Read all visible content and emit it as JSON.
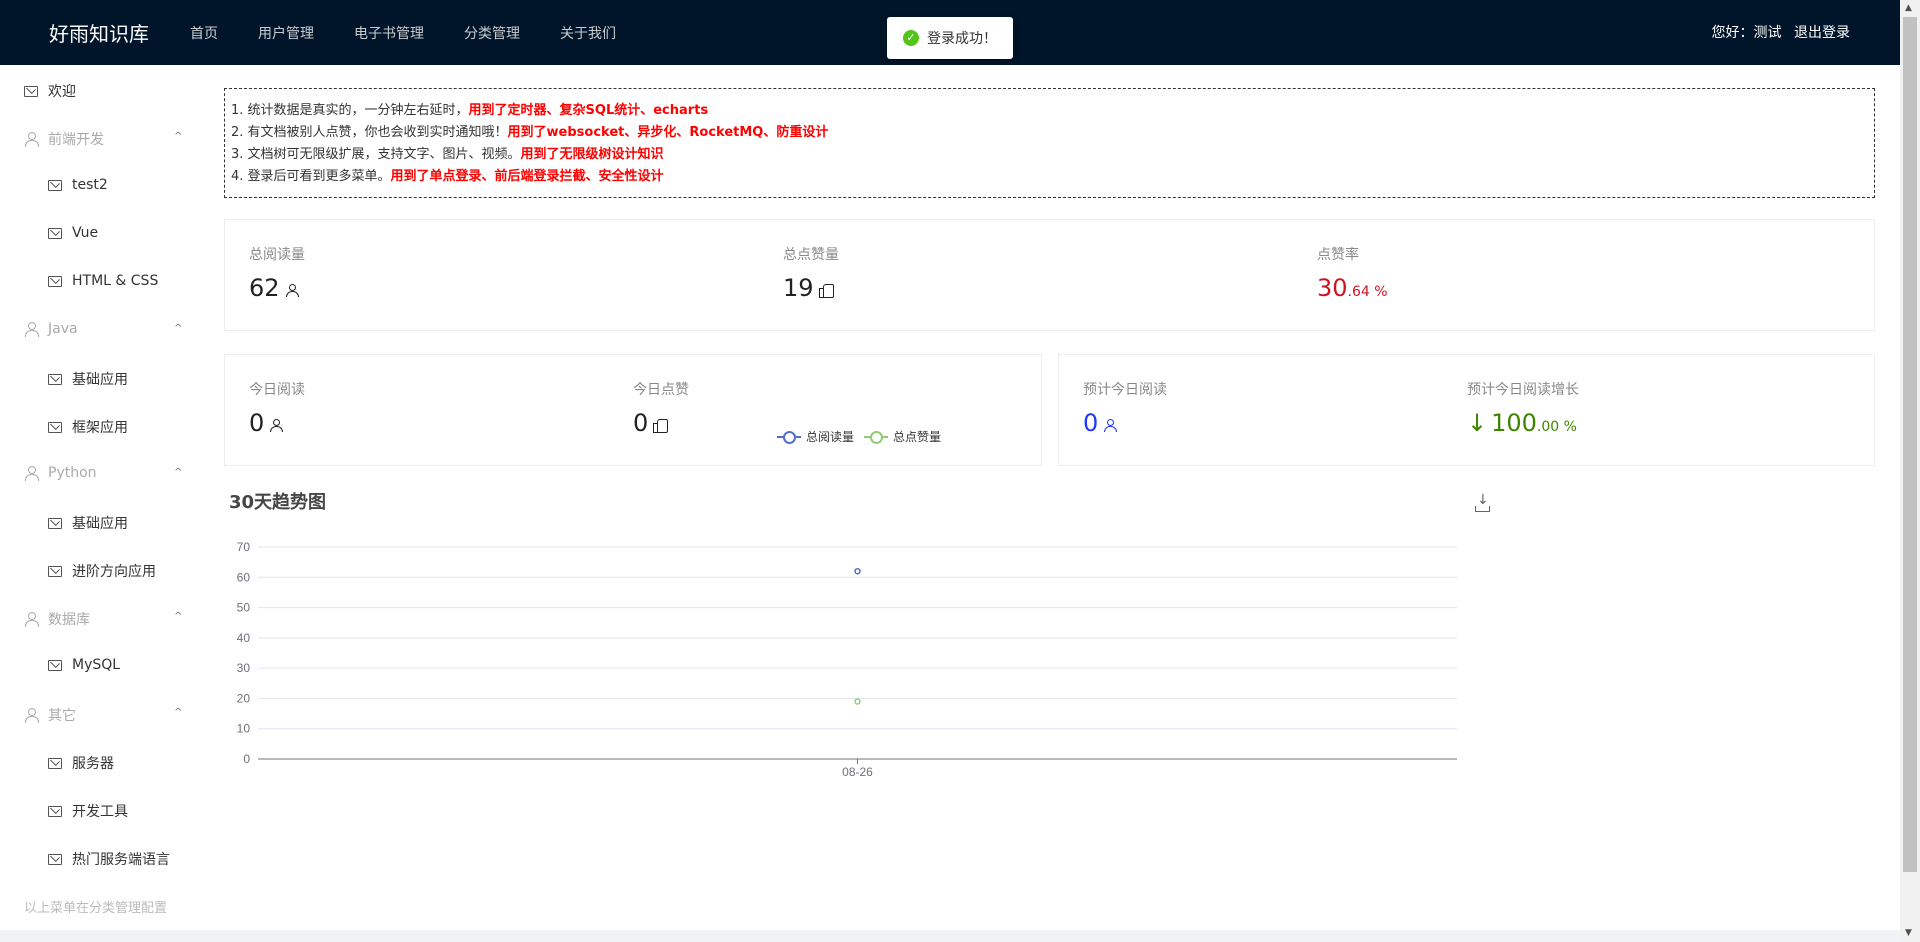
{
  "header": {
    "logo": "好雨知识库",
    "nav": [
      "首页",
      "用户管理",
      "电子书管理",
      "分类管理",
      "关于我们"
    ],
    "greeting": "您好：测试",
    "logout": "退出登录"
  },
  "toast": {
    "message": "登录成功！"
  },
  "sidebar": {
    "welcome": "欢迎",
    "groups": [
      {
        "label": "前端开发",
        "items": [
          "test2",
          "Vue",
          "HTML & CSS"
        ]
      },
      {
        "label": "Java",
        "items": [
          "基础应用",
          "框架应用"
        ]
      },
      {
        "label": "Python",
        "items": [
          "基础应用",
          "进阶方向应用"
        ]
      },
      {
        "label": "数据库",
        "items": [
          "MySQL"
        ]
      },
      {
        "label": "其它",
        "items": [
          "服务器",
          "开发工具",
          "热门服务端语言"
        ]
      }
    ],
    "footnote": "以上菜单在分类管理配置",
    "caret": "^"
  },
  "tips": [
    {
      "text": "1. 统计数据是真实的，一分钟左右延时，",
      "highlight": "用到了定时器、复杂SQL统计、echarts"
    },
    {
      "text": "2. 有文档被别人点赞，你也会收到实时通知哦！",
      "highlight": "用到了websocket、异步化、RocketMQ、防重设计"
    },
    {
      "text": "3. 文档树可无限级扩展，支持文字、图片、视频。",
      "highlight": "用到了无限级树设计知识"
    },
    {
      "text": "4. 登录后可看到更多菜单。",
      "highlight": "用到了单点登录、前后端登录拦截、安全性设计"
    }
  ],
  "stats": {
    "total_view": {
      "title": "总阅读量",
      "value": "62"
    },
    "total_vote": {
      "title": "总点赞量",
      "value": "19"
    },
    "vote_rate": {
      "title": "点赞率",
      "value": "30",
      "decimal": ".64 %"
    },
    "today_view": {
      "title": "今日阅读",
      "value": "0"
    },
    "today_vote": {
      "title": "今日点赞",
      "value": "0"
    },
    "est_today_view": {
      "title": "预计今日阅读",
      "value": "0"
    },
    "est_growth": {
      "title": "预计今日阅读增长",
      "value": "100",
      "decimal": ".00 %"
    }
  },
  "colors": {
    "header_bg": "#001529",
    "red": "#cf1322",
    "blue": "#1e36ff",
    "green": "#3f8600",
    "series_view": "#5470c6",
    "series_vote": "#91cc75"
  },
  "chart_data": {
    "type": "line",
    "title": "30天趋势图",
    "categories": [
      "08-26"
    ],
    "series": [
      {
        "name": "总阅读量",
        "values": [
          62
        ],
        "color": "#5470c6"
      },
      {
        "name": "总点赞量",
        "values": [
          19
        ],
        "color": "#91cc75"
      }
    ],
    "ylim": [
      0,
      70
    ],
    "yticks": [
      0,
      10,
      20,
      30,
      40,
      50,
      60,
      70
    ],
    "grid": true,
    "legend": "top-center"
  }
}
